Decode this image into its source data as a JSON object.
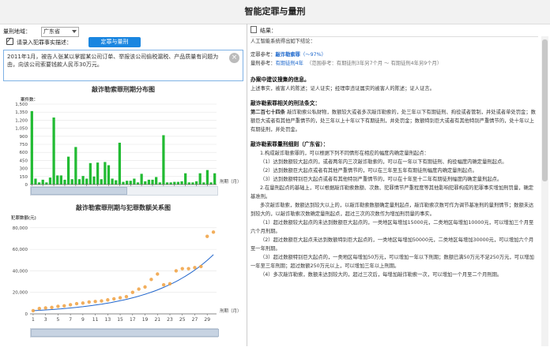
{
  "app_title": "智能定罪与量刑",
  "form": {
    "region_label": "量刑地域：",
    "region_value": "广东省",
    "case_label": "请录入犯罪事实描述：",
    "submit_label": "定罪与量刑",
    "case_text": "2011年1月，被告人张某以掌握某公司订单、举报该公司偷税漏税、产品质量有问题为由，向该公司索要钱款人民币30万元。"
  },
  "chart1": {
    "title": "敲诈勒索罪刑期分布图",
    "ylabel": "案件数：",
    "xlabel": "刑期（月）",
    "chart_data": {
      "type": "bar",
      "title": "敲诈勒索罪刑期分布图",
      "ylabel": "案件数：",
      "xlabel": "刑期（月）",
      "ylim": [
        0,
        1500
      ],
      "yticks": [
        "0",
        "150",
        "300",
        "450",
        "600",
        "750",
        "900",
        "1,050",
        "1,200",
        "1,350",
        "1,500"
      ],
      "xticks": [
        "0",
        "3",
        "6",
        "9",
        "12",
        "15",
        "18",
        "21",
        "24",
        "27",
        "30",
        "33",
        "36",
        "39",
        "42",
        "45",
        "48"
      ],
      "x": [
        0,
        1,
        2,
        3,
        4,
        5,
        6,
        7,
        8,
        9,
        10,
        11,
        12,
        13,
        14,
        15,
        16,
        17,
        18,
        19,
        20,
        21,
        22,
        23,
        24,
        25,
        26,
        27,
        28,
        29,
        30,
        31,
        32,
        33,
        34,
        35,
        36,
        37,
        38,
        39,
        40,
        41,
        42,
        43,
        44,
        45,
        46,
        47,
        48,
        49,
        50
      ],
      "values": [
        1370,
        110,
        40,
        90,
        40,
        130,
        1250,
        170,
        170,
        90,
        520,
        100,
        700,
        100,
        160,
        110,
        400,
        150,
        410,
        100,
        420,
        360,
        110,
        80,
        780,
        50,
        70,
        70,
        110,
        40,
        200,
        60,
        90,
        90,
        140,
        40,
        920,
        40,
        40,
        50,
        50,
        60,
        210,
        40,
        40,
        60,
        210,
        40,
        270,
        40,
        210
      ]
    }
  },
  "chart2": {
    "title": "敲诈勒索罪刑期与犯罪数额关系图",
    "ylabel": "犯罪数额(元)",
    "xlabel": "刑期（月）",
    "chart_data": {
      "type": "scatter",
      "title": "敲诈勒索罪刑期与犯罪数额关系图",
      "ylabel": "犯罪数额(元)",
      "xlabel": "刑期（月）",
      "ylim": [
        0,
        85000
      ],
      "yticks": [
        "0",
        "20,000",
        "40,000",
        "60,000",
        "80,000"
      ],
      "xticks": [
        "1",
        "3",
        "5",
        "7",
        "9",
        "11",
        "13",
        "15",
        "17",
        "19",
        "21",
        "23",
        "25",
        "27",
        "29"
      ],
      "x": [
        1,
        2,
        3,
        4,
        5,
        6,
        7,
        8,
        9,
        10,
        11,
        12,
        13,
        14,
        15,
        16,
        17,
        18,
        19,
        20,
        21,
        22,
        23,
        24,
        25,
        26,
        27,
        28,
        29,
        30
      ],
      "values": [
        3000,
        5000,
        5500,
        6000,
        7000,
        7500,
        8500,
        9500,
        10000,
        11000,
        11500,
        12000,
        13000,
        14000,
        15000,
        16000,
        20000,
        23000,
        25000,
        32000,
        37000,
        27000,
        28000,
        40000,
        42000,
        42000,
        43000,
        44000,
        72000,
        76000
      ],
      "trend": {
        "type": "exponential",
        "start": 3000,
        "end": 55000
      }
    }
  },
  "result": {
    "header": "结果：",
    "intro": "人工智能系统得出如下结论：",
    "crime_label": "定罪参考：",
    "crime_value": "敲诈勒索罪",
    "crime_prob": "（～97%）",
    "term_label": "量刑参考：",
    "term_value": "有期徒刑4年",
    "term_range": "（范围参考：有期徒刑3年另7个月 ～ 有期徒刑4年另9个月）",
    "sec1_title": "办案中建议搜集的信息。",
    "sec1_text": "上述事实，被害人的陈述；证人证实；经理审违证属实的被害人的陈述；证人证言。",
    "sec2_title": "敲诈勒索罪相关的刑法条文：",
    "sec2_article": "第二百七十四条",
    "sec2_text": "敲诈勒索公私财物，数额较大或者多次敲诈勒索的，处三年以下有期徒刑、拘役或者管制，并处或者单处罚金；数额巨大或者有其他严重情节的，处三年以上十年以下有期徒刑，并处罚金；数额特别巨大或者有其他特别严重情节的，处十年以上有期徒刑，并处罚金。",
    "sec3_title": "敲诈勒索罪量刑细则（广东省）：",
    "paras": [
      "1.构成敲诈勒索罪的，可以根据下列不同情形在相应的幅度内确定量刑起点：",
      "（1）达到数额较大起点的，或者两年内三次敲诈勒索的，可以在一年以下有期徒刑、拘役幅度内确定量刑起点。",
      "（2）达到数额巨大起点或者有其他严重情节的，可以在三年至五年有期徒刑幅度内确定量刑起点。",
      "（3）达到数额特别巨大起点或者有其他特别严重情节的，可以在十年至十二年有期徒刑幅度内确定量刑起点。",
      "2.在量刑起点的基础上，可以根据敲诈勒索数额、次数、犯罪情节严重程度等其他影响犯罪构成的犯罪事实增加刑罚量，确定基准刑。",
      "多次敲诈勒索，数额达到较大以上的，以敲诈勒索数额确定量刑起点，敲诈勒索次数可作为调节基准刑的量刑情节；数额未达到较大的，以敲诈勒索次数确定量刑起点，超过三次的次数作为增加刑罚量的事实。",
      "（1）超过数额较大起点的未达到数额巨大起点的，一类地区每增加15000元，二类地区每增加10000元，可以增加三个月至六个月刑期。",
      "（2）超过数额巨大起点未达到数额特别巨大起点的，一类地区每增加50000元，二类地区每增加30000元，可以增加六个月至一年刑期。",
      "（3）超过数额特别巨大起点的，一类地区每增加50万元，可以增加一年以下刑期；数额已满50万元不足250万元，可以增加一年至三年刑期；超过数额250万元以上，可以增加三年以上刑期。",
      "（4）多次敲诈勒索，数额未达到较大的，超过三次后，每增加敲诈勒索一次，可以增加一个月至二个月刑期。"
    ]
  },
  "colors": {
    "accent": "#1a86e0",
    "bar": "#22bb33",
    "scatter": "#f0a040",
    "trend": "#2266cc"
  }
}
